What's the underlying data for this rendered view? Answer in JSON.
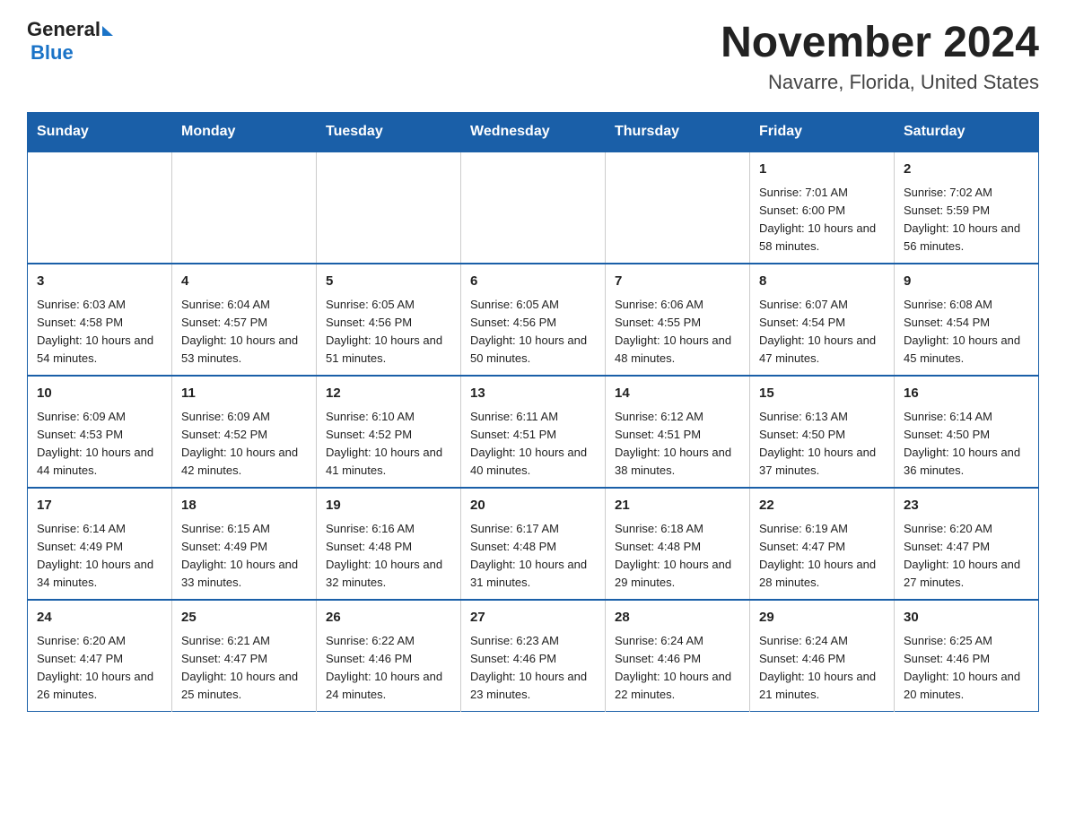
{
  "logo": {
    "general": "General",
    "blue": "Blue",
    "triangle": "▶"
  },
  "header": {
    "title": "November 2024",
    "subtitle": "Navarre, Florida, United States"
  },
  "days": {
    "headers": [
      "Sunday",
      "Monday",
      "Tuesday",
      "Wednesday",
      "Thursday",
      "Friday",
      "Saturday"
    ]
  },
  "weeks": [
    {
      "cells": [
        {
          "day": "",
          "info": ""
        },
        {
          "day": "",
          "info": ""
        },
        {
          "day": "",
          "info": ""
        },
        {
          "day": "",
          "info": ""
        },
        {
          "day": "",
          "info": ""
        },
        {
          "day": "1",
          "info": "Sunrise: 7:01 AM\nSunset: 6:00 PM\nDaylight: 10 hours and 58 minutes."
        },
        {
          "day": "2",
          "info": "Sunrise: 7:02 AM\nSunset: 5:59 PM\nDaylight: 10 hours and 56 minutes."
        }
      ]
    },
    {
      "cells": [
        {
          "day": "3",
          "info": "Sunrise: 6:03 AM\nSunset: 4:58 PM\nDaylight: 10 hours and 54 minutes."
        },
        {
          "day": "4",
          "info": "Sunrise: 6:04 AM\nSunset: 4:57 PM\nDaylight: 10 hours and 53 minutes."
        },
        {
          "day": "5",
          "info": "Sunrise: 6:05 AM\nSunset: 4:56 PM\nDaylight: 10 hours and 51 minutes."
        },
        {
          "day": "6",
          "info": "Sunrise: 6:05 AM\nSunset: 4:56 PM\nDaylight: 10 hours and 50 minutes."
        },
        {
          "day": "7",
          "info": "Sunrise: 6:06 AM\nSunset: 4:55 PM\nDaylight: 10 hours and 48 minutes."
        },
        {
          "day": "8",
          "info": "Sunrise: 6:07 AM\nSunset: 4:54 PM\nDaylight: 10 hours and 47 minutes."
        },
        {
          "day": "9",
          "info": "Sunrise: 6:08 AM\nSunset: 4:54 PM\nDaylight: 10 hours and 45 minutes."
        }
      ]
    },
    {
      "cells": [
        {
          "day": "10",
          "info": "Sunrise: 6:09 AM\nSunset: 4:53 PM\nDaylight: 10 hours and 44 minutes."
        },
        {
          "day": "11",
          "info": "Sunrise: 6:09 AM\nSunset: 4:52 PM\nDaylight: 10 hours and 42 minutes."
        },
        {
          "day": "12",
          "info": "Sunrise: 6:10 AM\nSunset: 4:52 PM\nDaylight: 10 hours and 41 minutes."
        },
        {
          "day": "13",
          "info": "Sunrise: 6:11 AM\nSunset: 4:51 PM\nDaylight: 10 hours and 40 minutes."
        },
        {
          "day": "14",
          "info": "Sunrise: 6:12 AM\nSunset: 4:51 PM\nDaylight: 10 hours and 38 minutes."
        },
        {
          "day": "15",
          "info": "Sunrise: 6:13 AM\nSunset: 4:50 PM\nDaylight: 10 hours and 37 minutes."
        },
        {
          "day": "16",
          "info": "Sunrise: 6:14 AM\nSunset: 4:50 PM\nDaylight: 10 hours and 36 minutes."
        }
      ]
    },
    {
      "cells": [
        {
          "day": "17",
          "info": "Sunrise: 6:14 AM\nSunset: 4:49 PM\nDaylight: 10 hours and 34 minutes."
        },
        {
          "day": "18",
          "info": "Sunrise: 6:15 AM\nSunset: 4:49 PM\nDaylight: 10 hours and 33 minutes."
        },
        {
          "day": "19",
          "info": "Sunrise: 6:16 AM\nSunset: 4:48 PM\nDaylight: 10 hours and 32 minutes."
        },
        {
          "day": "20",
          "info": "Sunrise: 6:17 AM\nSunset: 4:48 PM\nDaylight: 10 hours and 31 minutes."
        },
        {
          "day": "21",
          "info": "Sunrise: 6:18 AM\nSunset: 4:48 PM\nDaylight: 10 hours and 29 minutes."
        },
        {
          "day": "22",
          "info": "Sunrise: 6:19 AM\nSunset: 4:47 PM\nDaylight: 10 hours and 28 minutes."
        },
        {
          "day": "23",
          "info": "Sunrise: 6:20 AM\nSunset: 4:47 PM\nDaylight: 10 hours and 27 minutes."
        }
      ]
    },
    {
      "cells": [
        {
          "day": "24",
          "info": "Sunrise: 6:20 AM\nSunset: 4:47 PM\nDaylight: 10 hours and 26 minutes."
        },
        {
          "day": "25",
          "info": "Sunrise: 6:21 AM\nSunset: 4:47 PM\nDaylight: 10 hours and 25 minutes."
        },
        {
          "day": "26",
          "info": "Sunrise: 6:22 AM\nSunset: 4:46 PM\nDaylight: 10 hours and 24 minutes."
        },
        {
          "day": "27",
          "info": "Sunrise: 6:23 AM\nSunset: 4:46 PM\nDaylight: 10 hours and 23 minutes."
        },
        {
          "day": "28",
          "info": "Sunrise: 6:24 AM\nSunset: 4:46 PM\nDaylight: 10 hours and 22 minutes."
        },
        {
          "day": "29",
          "info": "Sunrise: 6:24 AM\nSunset: 4:46 PM\nDaylight: 10 hours and 21 minutes."
        },
        {
          "day": "30",
          "info": "Sunrise: 6:25 AM\nSunset: 4:46 PM\nDaylight: 10 hours and 20 minutes."
        }
      ]
    }
  ]
}
